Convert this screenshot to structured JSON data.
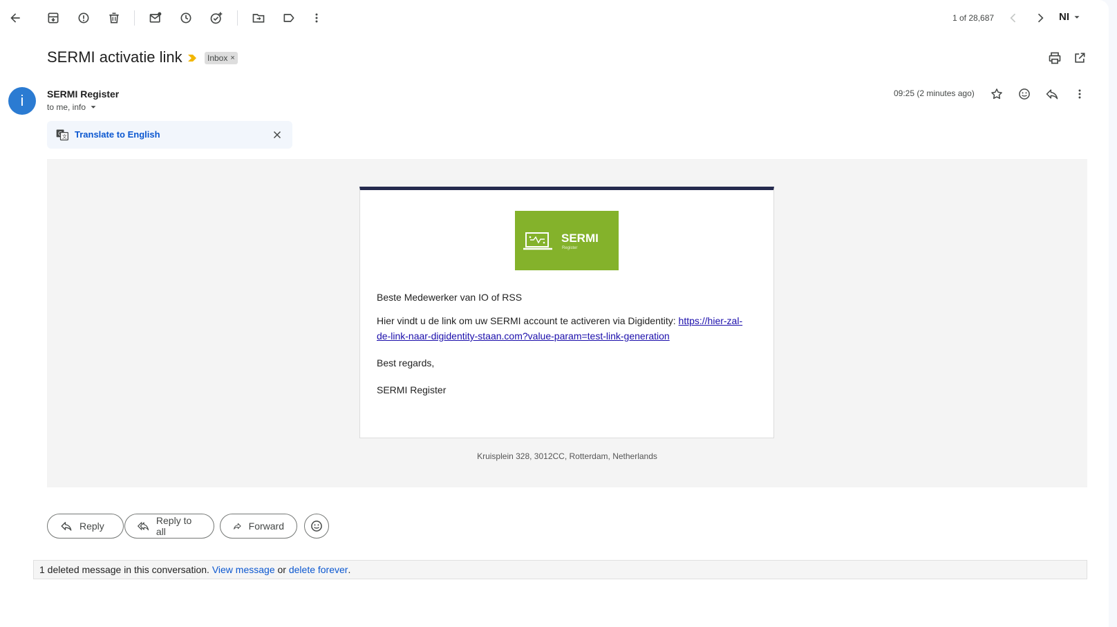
{
  "toolbar": {
    "pagination": "1 of 28,687",
    "account_initials": "NI"
  },
  "message": {
    "subject": "SERMI activatie link",
    "label": "Inbox",
    "label_remove": "×",
    "sender_name": "SERMI Register",
    "avatar_letter": "i",
    "recipients": "to me, info",
    "time": "09:25 (2 minutes ago)",
    "translate_label": "Translate to English"
  },
  "email": {
    "logo_title": "SERMI",
    "logo_subtitle": "Register",
    "greeting": "Beste Medewerker van IO of RSS",
    "body_prefix": "Hier vindt u de link om uw SERMI account te activeren via Digidentity: ",
    "link_line1": "https://hier-zal-",
    "link_line2": "de-link-naar-digidentity-staan.com?value-param=test-link-generation",
    "regards": "Best regards,",
    "signature": "SERMI Register",
    "address": "Kruisplein 328, 3012CC, Rotterdam, Netherlands"
  },
  "actions": {
    "reply": "Reply",
    "reply_all": "Reply to all",
    "forward": "Forward"
  },
  "deleted": {
    "prefix": "1 deleted message in this conversation. ",
    "view": "View message",
    "middle": " or ",
    "delete": "delete forever",
    "suffix": "."
  },
  "colors": {
    "logo_green": "#84b22b",
    "card_top_border": "#252a4e",
    "link_blue": "#0b57d0",
    "avatar_blue": "#2b7bd2"
  }
}
